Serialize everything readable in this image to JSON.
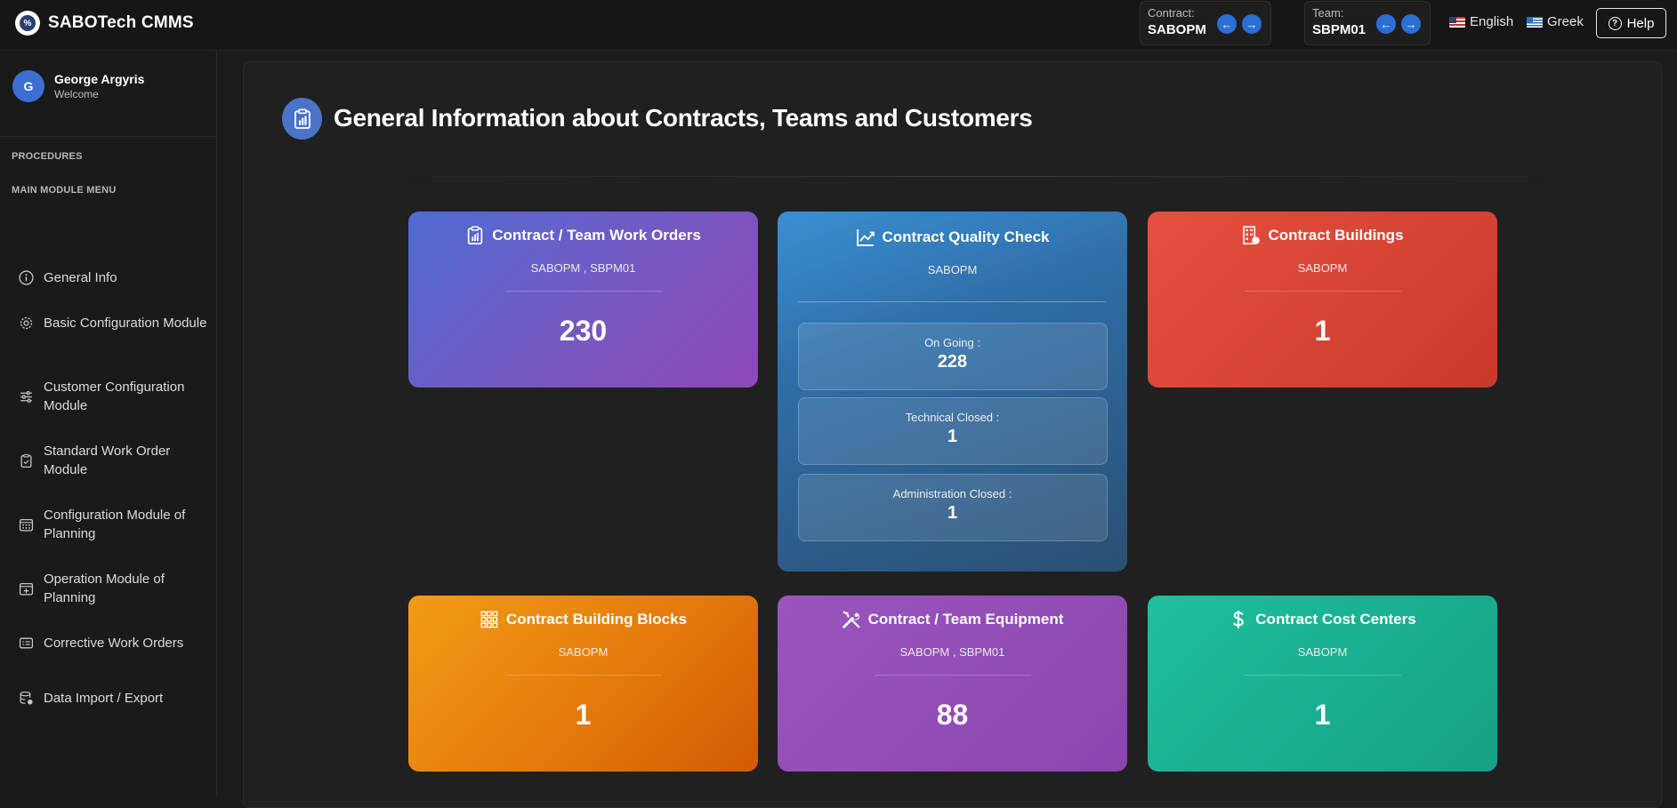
{
  "brand": {
    "name": "SABOTech CMMS"
  },
  "header": {
    "contract": {
      "label": "Contract:",
      "value": "SABOPM"
    },
    "team": {
      "label": "Team:",
      "value": "SBPM01"
    },
    "prev_arrow": "←",
    "next_arrow": "→",
    "languages": [
      "English",
      "Greek"
    ],
    "help_label": "Help",
    "accent_color": "#2b6ed6"
  },
  "user": {
    "initial": "G",
    "name": "George Argyris",
    "subtitle": "Welcome"
  },
  "sidebar": {
    "section_procedures": "PROCEDURES",
    "section_main": "MAIN MODULE MENU",
    "items": [
      {
        "label": "General Info",
        "icon": "info-icon"
      },
      {
        "label": "Basic Configuration Module",
        "icon": "gear-icon"
      },
      {
        "label": "Customer Configuration Module",
        "icon": "sliders-icon"
      },
      {
        "label": "Standard Work Order Module",
        "icon": "clipboard-icon"
      },
      {
        "label": "Configuration Module of Planning",
        "icon": "calendar-grid-icon"
      },
      {
        "label": "Operation Module of Planning",
        "icon": "calendar-plus-icon"
      },
      {
        "label": "Corrective Work Orders",
        "icon": "list-card-icon"
      },
      {
        "label": "Data Import / Export",
        "icon": "database-icon"
      }
    ]
  },
  "main": {
    "title": "General Information about Contracts, Teams and Customers",
    "cards": {
      "work_orders": {
        "title": "Contract / Team Work Orders",
        "subtitle": "SABOPM , SBPM01",
        "value": "230",
        "color": "#6a5fc8"
      },
      "quality_check": {
        "title": "Contract Quality Check",
        "subtitle": "SABOPM",
        "color": "#2f6ea8",
        "rows": [
          {
            "label": "On Going :",
            "value": "228"
          },
          {
            "label": "Technical Closed :",
            "value": "1"
          },
          {
            "label": "Administration Closed :",
            "value": "1"
          }
        ]
      },
      "buildings": {
        "title": "Contract Buildings",
        "subtitle": "SABOPM",
        "value": "1",
        "color": "#e64f3f"
      },
      "building_blocks": {
        "title": "Contract Building Blocks",
        "subtitle": "SABOPM",
        "value": "1",
        "color": "#e67e0c"
      },
      "equipment": {
        "title": "Contract / Team Equipment",
        "subtitle": "SABOPM , SBPM01",
        "value": "88",
        "color": "#9a55bd"
      },
      "cost_centers": {
        "title": "Contract Cost Centers",
        "subtitle": "SABOPM",
        "value": "1",
        "color": "#1abc9c"
      }
    }
  }
}
